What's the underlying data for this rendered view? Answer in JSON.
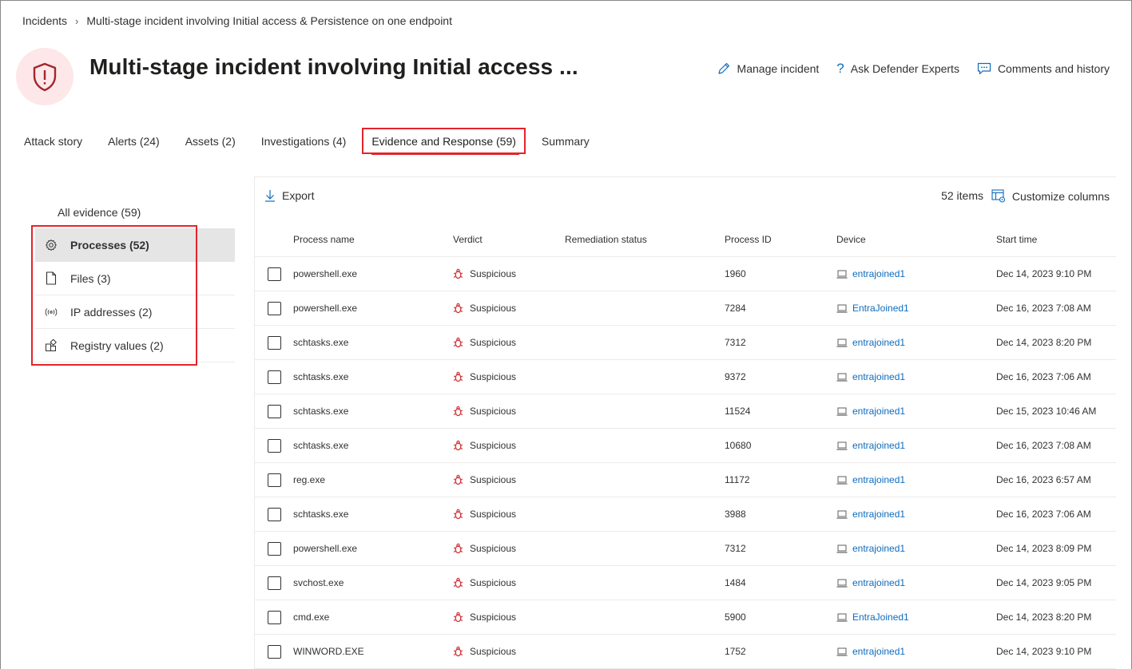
{
  "breadcrumb": {
    "root": "Incidents",
    "current": "Multi-stage incident involving Initial access & Persistence on one endpoint"
  },
  "header": {
    "title": "Multi-stage incident involving Initial access ...",
    "actions": {
      "manage": "Manage incident",
      "ask": "Ask Defender Experts",
      "comments": "Comments and history"
    },
    "icon": "shield-alert-icon",
    "accent_color": "#a4262c"
  },
  "tabs": [
    {
      "label": "Attack story"
    },
    {
      "label": "Alerts (24)"
    },
    {
      "label": "Assets (2)"
    },
    {
      "label": "Investigations (4)"
    },
    {
      "label": "Evidence and Response (59)"
    },
    {
      "label": "Summary"
    }
  ],
  "sidebar": {
    "all": "All evidence (59)",
    "items": [
      {
        "label": "Processes (52)",
        "icon": "gear-icon"
      },
      {
        "label": "Files (3)",
        "icon": "file-icon"
      },
      {
        "label": "IP addresses (2)",
        "icon": "broadcast-icon"
      },
      {
        "label": "Registry values (2)",
        "icon": "registry-icon"
      }
    ]
  },
  "toolbar": {
    "export": "Export",
    "count": "52 items",
    "customize": "Customize columns"
  },
  "table": {
    "headers": {
      "name": "Process name",
      "verdict": "Verdict",
      "remediation": "Remediation status",
      "pid": "Process ID",
      "device": "Device",
      "start": "Start time"
    },
    "rows": [
      {
        "name": "powershell.exe",
        "verdict": "Suspicious",
        "remediation": "",
        "pid": "1960",
        "device": "entrajoined1",
        "start": "Dec 14, 2023 9:10 PM"
      },
      {
        "name": "powershell.exe",
        "verdict": "Suspicious",
        "remediation": "",
        "pid": "7284",
        "device": "EntraJoined1",
        "start": "Dec 16, 2023 7:08 AM"
      },
      {
        "name": "schtasks.exe",
        "verdict": "Suspicious",
        "remediation": "",
        "pid": "7312",
        "device": "entrajoined1",
        "start": "Dec 14, 2023 8:20 PM"
      },
      {
        "name": "schtasks.exe",
        "verdict": "Suspicious",
        "remediation": "",
        "pid": "9372",
        "device": "entrajoined1",
        "start": "Dec 16, 2023 7:06 AM"
      },
      {
        "name": "schtasks.exe",
        "verdict": "Suspicious",
        "remediation": "",
        "pid": "11524",
        "device": "entrajoined1",
        "start": "Dec 15, 2023 10:46 AM"
      },
      {
        "name": "schtasks.exe",
        "verdict": "Suspicious",
        "remediation": "",
        "pid": "10680",
        "device": "entrajoined1",
        "start": "Dec 16, 2023 7:08 AM"
      },
      {
        "name": "reg.exe",
        "verdict": "Suspicious",
        "remediation": "",
        "pid": "11172",
        "device": "entrajoined1",
        "start": "Dec 16, 2023 6:57 AM"
      },
      {
        "name": "schtasks.exe",
        "verdict": "Suspicious",
        "remediation": "",
        "pid": "3988",
        "device": "entrajoined1",
        "start": "Dec 16, 2023 7:06 AM"
      },
      {
        "name": "powershell.exe",
        "verdict": "Suspicious",
        "remediation": "",
        "pid": "7312",
        "device": "entrajoined1",
        "start": "Dec 14, 2023 8:09 PM"
      },
      {
        "name": "svchost.exe",
        "verdict": "Suspicious",
        "remediation": "",
        "pid": "1484",
        "device": "entrajoined1",
        "start": "Dec 14, 2023 9:05 PM"
      },
      {
        "name": "cmd.exe",
        "verdict": "Suspicious",
        "remediation": "",
        "pid": "5900",
        "device": "EntraJoined1",
        "start": "Dec 14, 2023 8:20 PM"
      },
      {
        "name": "WINWORD.EXE",
        "verdict": "Suspicious",
        "remediation": "",
        "pid": "1752",
        "device": "entrajoined1",
        "start": "Dec 14, 2023 9:10 PM"
      }
    ]
  },
  "colors": {
    "link": "#0f6cbd",
    "highlight_box": "#e3242b",
    "suspicious": "#d13438"
  }
}
